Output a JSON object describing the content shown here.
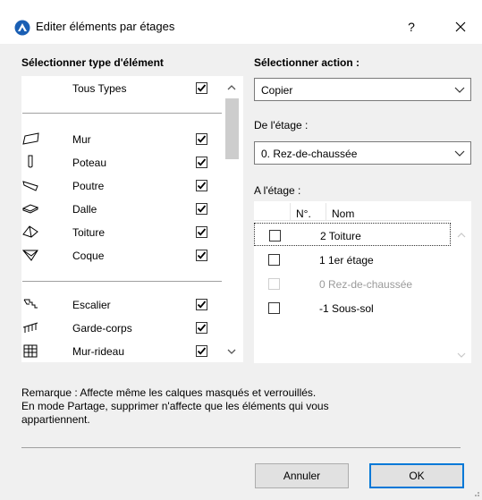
{
  "window": {
    "title": "Editer éléments par étages",
    "help_label": "?"
  },
  "left": {
    "title": "Sélectionner type d'élément",
    "items": [
      {
        "label": "Tous Types",
        "checked": true,
        "icon": "none"
      },
      {
        "label": "Mur",
        "checked": true,
        "icon": "wall-icon"
      },
      {
        "label": "Poteau",
        "checked": true,
        "icon": "column-icon"
      },
      {
        "label": "Poutre",
        "checked": true,
        "icon": "beam-icon"
      },
      {
        "label": "Dalle",
        "checked": true,
        "icon": "slab-icon"
      },
      {
        "label": "Toiture",
        "checked": true,
        "icon": "roof-icon"
      },
      {
        "label": "Coque",
        "checked": true,
        "icon": "shell-icon"
      },
      {
        "label": "Escalier",
        "checked": true,
        "icon": "stair-icon"
      },
      {
        "label": "Garde-corps",
        "checked": true,
        "icon": "railing-icon"
      },
      {
        "label": "Mur-rideau",
        "checked": true,
        "icon": "curtain-wall-icon"
      }
    ]
  },
  "right": {
    "action_title": "Sélectionner action :",
    "action_value": "Copier",
    "from_title": "De l'étage :",
    "from_value": "0. Rez-de-chaussée",
    "to_title": "A l'étage :",
    "columns": {
      "num": "N°.",
      "name": "Nom"
    },
    "floors": [
      {
        "label": "2 Toiture",
        "checked": false,
        "enabled": true,
        "focused": true
      },
      {
        "label": "1 1er étage",
        "checked": false,
        "enabled": true
      },
      {
        "label": "0 Rez-de-chaussée",
        "checked": false,
        "enabled": false
      },
      {
        "label": "-1 Sous-sol",
        "checked": false,
        "enabled": true
      }
    ]
  },
  "remark": {
    "line1": "Remarque : Affecte même les calques masqués et verrouillés.",
    "line2": "En mode Partage, supprimer n'affecte que les éléments qui vous",
    "line3": "appartiennent."
  },
  "buttons": {
    "cancel": "Annuler",
    "ok": "OK"
  },
  "colors": {
    "accent": "#0078d7",
    "window_bg": "#f0f0f0",
    "check": "#000000"
  }
}
